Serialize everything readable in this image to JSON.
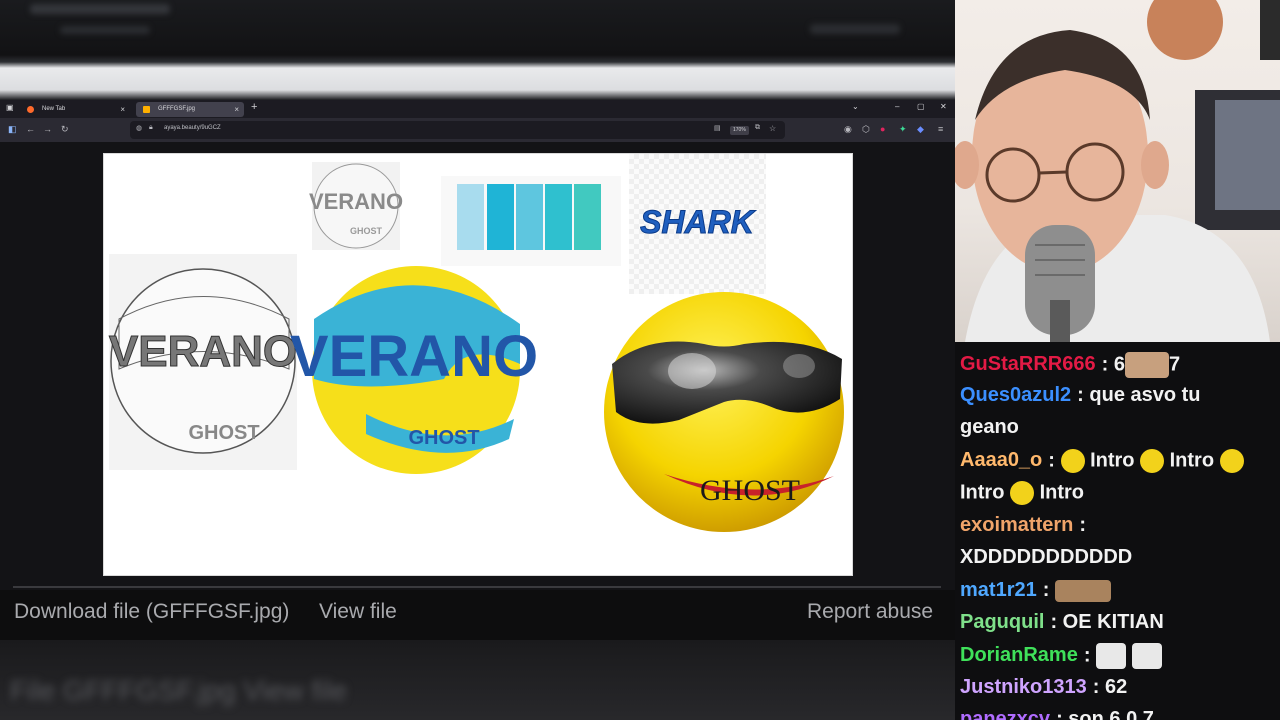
{
  "browser": {
    "tabs": [
      {
        "label": "New Tab"
      },
      {
        "label": "GFFFGSF.jpg"
      }
    ],
    "url": "ayaya.beauty/9uGCZ",
    "zoom": "170%"
  },
  "image": {
    "shark_text": "SHARK",
    "verano_text": "VERANO",
    "ghost_text": "GHOST",
    "palette": [
      "#a8dcee",
      "#1fb4d6",
      "#5ec6df",
      "#2fc0cf",
      "#41c9c0"
    ]
  },
  "page": {
    "download_label": "Download file (GFFFGSF.jpg)",
    "view_label": "View file",
    "report_label": "Report abuse",
    "blurred_footer": "File GFFFGSF.jpg   View file"
  },
  "chat": {
    "messages": [
      {
        "user": "GuStaRRR666",
        "color": "#e31a45",
        "pre": "6",
        "post": "7"
      },
      {
        "user": "Ques0azul2",
        "color": "#3b8fff",
        "text1": "que asvo tu",
        "text2": "geano"
      },
      {
        "user": "Aaaa0_o",
        "color": "#ffb86c",
        "text1": "Intro",
        "text2": "Intro",
        "text3": "Intro",
        "text4": "Intro"
      },
      {
        "user": "exoimattern",
        "color": "#f0a46a",
        "text1": "XDDDDDDDDDDD"
      },
      {
        "user": "mat1r21",
        "color": "#4fa8ff"
      },
      {
        "user": "Paguquil",
        "color": "#7fe08a",
        "text1": "OE KITIAN"
      },
      {
        "user": "DorianRame",
        "color": "#3fe05a"
      },
      {
        "user": "Justniko1313",
        "color": "#cfa4ff",
        "text1": "62"
      },
      {
        "user": "panezxcv",
        "color": "#b06cff",
        "text1": "son 6 0 7"
      }
    ]
  }
}
